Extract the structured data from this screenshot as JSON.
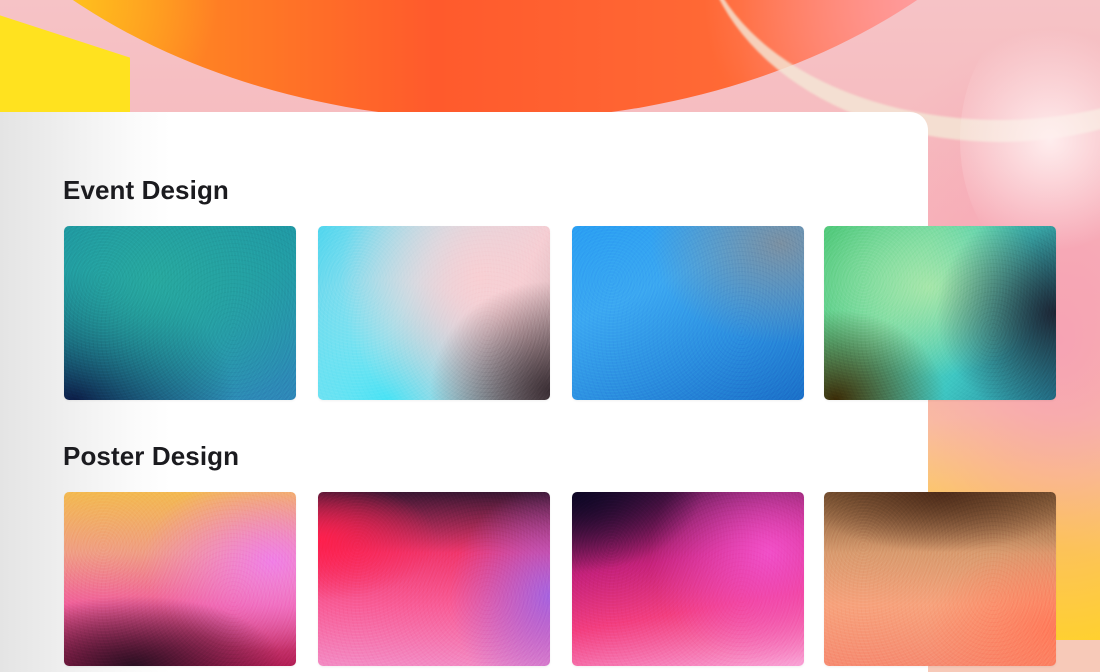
{
  "sections": [
    {
      "title": "Event Design",
      "tiles": [
        {
          "name": "teal-gradient-thumbnail"
        },
        {
          "name": "cyan-pink-gradient-thumbnail"
        },
        {
          "name": "blue-gradient-thumbnail"
        },
        {
          "name": "green-cyan-gradient-thumbnail"
        }
      ]
    },
    {
      "title": "Poster Design",
      "tiles": [
        {
          "name": "orange-pink-gradient-thumbnail"
        },
        {
          "name": "red-purple-gradient-thumbnail"
        },
        {
          "name": "magenta-gradient-thumbnail"
        },
        {
          "name": "brown-peach-gradient-thumbnail"
        }
      ]
    }
  ],
  "colors": {
    "heading": "#1b1b1f",
    "card_background": "#ffffff",
    "backdrop_orange": "#ff5a2c",
    "backdrop_yellow": "#ffd52f",
    "backdrop_pink": "#f7a3b4"
  }
}
